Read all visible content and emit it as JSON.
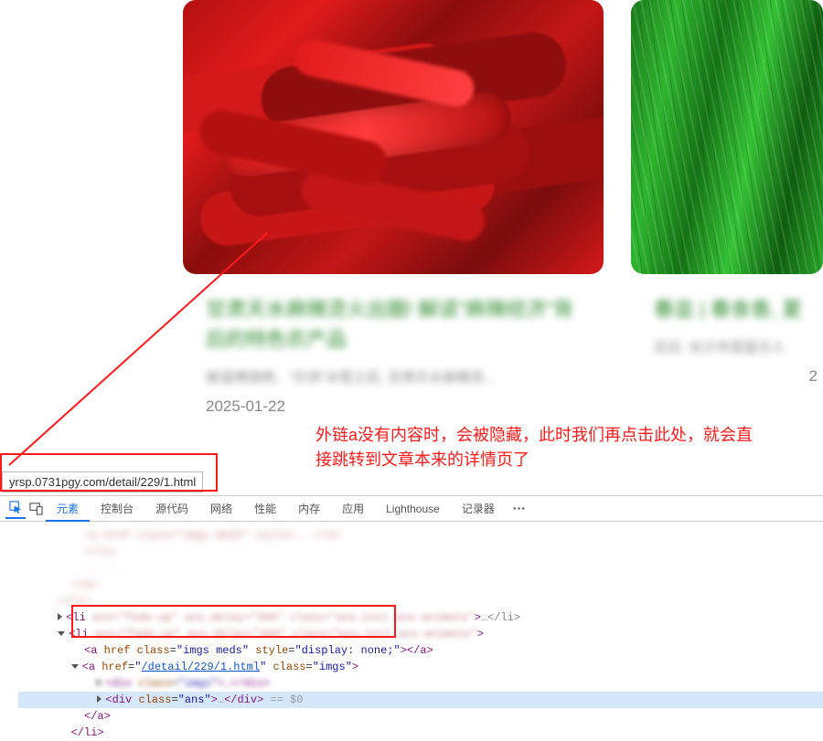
{
  "cards": [
    {
      "title": "甘肃天水麻辣烫火出圈! 解读\"麻辣经济\"背后的特色农产品",
      "desc": "继淄博烧烤、\"尔滨\"冰雪之后, 甘肃天水麻辣烫...",
      "date": "2025-01-22"
    },
    {
      "title": "春韭 | 春食香, 夏",
      "desc": "近日, 长沙市菜篮次人",
      "date": "2"
    }
  ],
  "annotation": {
    "text_line1": "外链a没有内容时，会被隐藏，此时我们再点击此处，就会直",
    "text_line2": "接跳转到文章本来的详情页了"
  },
  "url_tooltip": "yrsp.0731pgy.com/detail/229/1.html",
  "devtools": {
    "tabs": [
      "元素",
      "控制台",
      "源代码",
      "网络",
      "性能",
      "内存",
      "应用",
      "Lighthouse",
      "记录器"
    ],
    "active_tab": "元素",
    "li_tail_1": "…</li>",
    "li_tail_2": "",
    "a1": {
      "tag": "a",
      "class": "imgs meds",
      "style": "display: none;",
      "close": "></a>"
    },
    "a2": {
      "tag": "a",
      "href": "/detail/229/1.html",
      "class": "imgs",
      "close": ">"
    },
    "div1": {
      "tag": "div",
      "class": "imgs",
      "tail": ">…</div>"
    },
    "div2": {
      "tag": "div",
      "class": "ans",
      "tail": ">…</div>",
      "sel": " == $0"
    },
    "close_a": "</a>",
    "close_li": "</li>"
  }
}
